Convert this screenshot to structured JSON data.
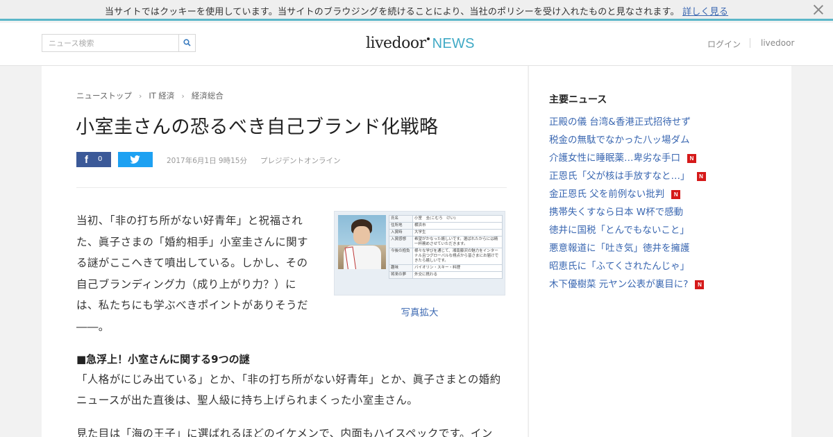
{
  "cookie_banner": {
    "text": "当サイトではクッキーを使用しています。当サイトのブラウジングを続けることにより、当社のポリシーを受け入れたものと見なされます。",
    "link": "詳しく見る",
    "close_icon": "close-icon"
  },
  "header": {
    "search": {
      "placeholder": "ニュース検索",
      "value": "",
      "icon": "search-icon"
    },
    "logo": {
      "main": "livedoor",
      "sub": "NEWS"
    },
    "login": "ログイン",
    "livedoor_link": "livedoor",
    "accent_color": "#3fa9c5"
  },
  "breadcrumb": [
    "ニューストップ",
    "IT 経済",
    "経済総合"
  ],
  "article": {
    "title": "小室圭さんの恐るべき自己ブランド化戦略",
    "share": {
      "facebook_icon": "f",
      "facebook_count": "0",
      "twitter_icon": "twitter-bird-icon"
    },
    "date": "2017年6月1日 9時15分",
    "source": "プレジデントオンライン",
    "lead": "当初、「非の打ち所がない好青年」と祝福された、眞子さまの「婚約相手」小室圭さんに関する謎がここへきて噴出している。しかし、その自己ブランディング力（成り上がり力？）には、私たちにも学ぶべきポイントがありそうだ――。",
    "photo": {
      "caption": "写真拡大",
      "table": [
        {
          "k": "氏名",
          "v": "小室　圭(こむろ　けい)"
        },
        {
          "k": "住所地",
          "v": "横浜市"
        },
        {
          "k": "入賞時",
          "v": "大学生"
        },
        {
          "k": "入賞感想",
          "v": "希望がかなった嬉しいです。選ばれたからには精一杯務めさせていただきます。"
        },
        {
          "k": "今後の抱負",
          "v": "様々な学びを通じて、湘南藤沢の魅力をインターナル且つグローバルな視点から皆さまにお届けできたら嬉しいです。"
        },
        {
          "k": "趣味",
          "v": "バイオリン・スキー・料理"
        },
        {
          "k": "将来の夢",
          "v": "外交に携わる"
        }
      ]
    },
    "section_heading": "■急浮上！小室さんに関する9つの謎",
    "paragraph1": "「人格がにじみ出ている」とか、「非の打ち所がない好青年」とか、眞子さまとの婚約ニュースが出た直後は、聖人級に持ち上げられまくった小室圭さん。",
    "paragraph2": "見た目は「海の王子」に選ばれるほどのイケメンで、内面もハイスペックです。イン"
  },
  "sidebar": {
    "heading": "主要ニュース",
    "items": [
      {
        "label": "正殿の儀 台湾&香港正式招待せず",
        "badge": ""
      },
      {
        "label": "税金の無駄でなかった八ッ場ダム",
        "badge": ""
      },
      {
        "label": "介護女性に睡眠薬…卑劣な手口",
        "badge": "N"
      },
      {
        "label": "正恩氏「父が核は手放すなと…」",
        "badge": "N"
      },
      {
        "label": "金正恩氏 父を前例ない批判",
        "badge": "N"
      },
      {
        "label": "携帯失くすなら日本 W杯で感動",
        "badge": ""
      },
      {
        "label": "徳井に国税「とんでもないこと」",
        "badge": ""
      },
      {
        "label": "悪意報道に「吐き気」徳井を擁護",
        "badge": ""
      },
      {
        "label": "昭恵氏に「ふてくされたんじゃ」",
        "badge": ""
      },
      {
        "label": "木下優樹菜 元ヤン公表が裏目に?",
        "badge": "N"
      }
    ],
    "badge_color": "#d51919",
    "link_color": "#3a67b1"
  }
}
